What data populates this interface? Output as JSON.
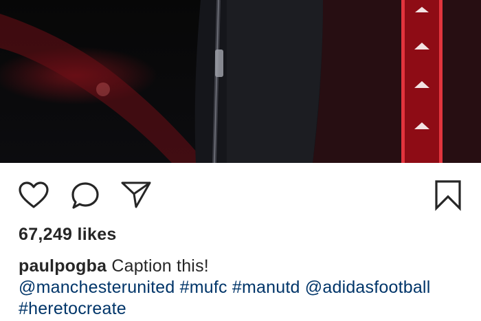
{
  "post": {
    "likes": "67,249 likes",
    "username": "paulpogba",
    "caption_text": "Caption this!",
    "mentions": {
      "m1": "@manchesterunited",
      "h1": "#mufc",
      "h2": "#manutd",
      "m2": "@adidasfootball",
      "h3": "#heretocreate"
    }
  },
  "actions": {
    "like_icon": "heart-icon",
    "comment_icon": "comment-bubble-icon",
    "share_icon": "paper-plane-icon",
    "save_icon": "bookmark-icon"
  },
  "colors": {
    "text": "#262626",
    "link": "#003569",
    "jacket_stripe": "#c8101e"
  }
}
